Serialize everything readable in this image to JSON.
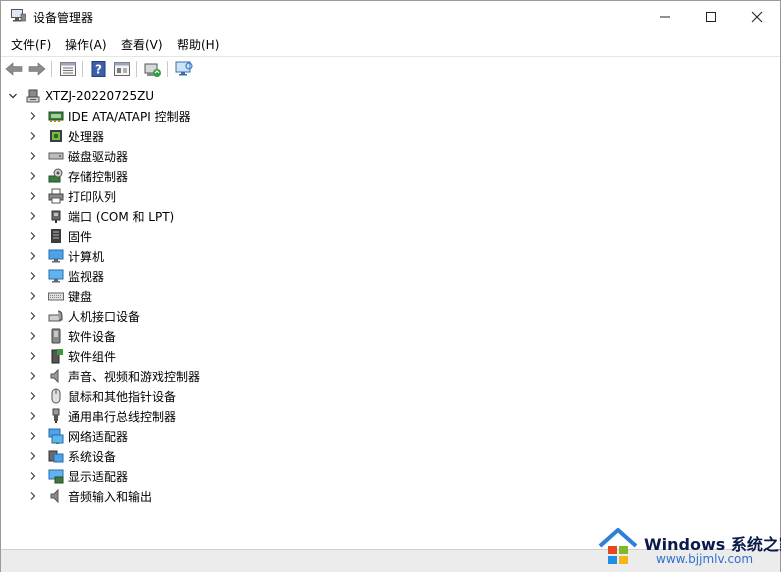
{
  "window": {
    "title": "设备管理器",
    "colors": {
      "background": "#ffffff",
      "accent": "#2e7fd8",
      "statusbar": "#ececec"
    }
  },
  "menu": [
    {
      "label": "文件(F)"
    },
    {
      "label": "操作(A)"
    },
    {
      "label": "查看(V)"
    },
    {
      "label": "帮助(H)"
    }
  ],
  "toolbar": {
    "icons": [
      "back-icon",
      "forward-icon",
      "properties-icon",
      "help-icon",
      "show-hidden-icon",
      "update-driver-icon",
      "monitor-scan-icon"
    ]
  },
  "tree": {
    "root": {
      "label": "XTZJ-20220725ZU",
      "icon": "computer-icon",
      "expanded": true
    },
    "nodes": [
      {
        "label": "IDE ATA/ATAPI 控制器",
        "icon": "ide-controller-icon"
      },
      {
        "label": "处理器",
        "icon": "processor-icon"
      },
      {
        "label": "磁盘驱动器",
        "icon": "disk-drive-icon"
      },
      {
        "label": "存储控制器",
        "icon": "storage-controller-icon"
      },
      {
        "label": "打印队列",
        "icon": "printer-icon"
      },
      {
        "label": "端口 (COM 和 LPT)",
        "icon": "port-icon"
      },
      {
        "label": "固件",
        "icon": "firmware-icon"
      },
      {
        "label": "计算机",
        "icon": "computer-monitor-icon"
      },
      {
        "label": "监视器",
        "icon": "monitor-icon"
      },
      {
        "label": "键盘",
        "icon": "keyboard-icon"
      },
      {
        "label": "人机接口设备",
        "icon": "hid-icon"
      },
      {
        "label": "软件设备",
        "icon": "software-device-icon"
      },
      {
        "label": "软件组件",
        "icon": "software-component-icon"
      },
      {
        "label": "声音、视频和游戏控制器",
        "icon": "speaker-icon"
      },
      {
        "label": "鼠标和其他指针设备",
        "icon": "mouse-icon"
      },
      {
        "label": "通用串行总线控制器",
        "icon": "usb-icon"
      },
      {
        "label": "网络适配器",
        "icon": "network-icon"
      },
      {
        "label": "系统设备",
        "icon": "system-device-icon"
      },
      {
        "label": "显示适配器",
        "icon": "display-adapter-icon"
      },
      {
        "label": "音频输入和输出",
        "icon": "audio-io-icon"
      }
    ]
  },
  "watermark": {
    "brand": "Windows 系统之家",
    "url": "www.bjjmlv.com"
  }
}
